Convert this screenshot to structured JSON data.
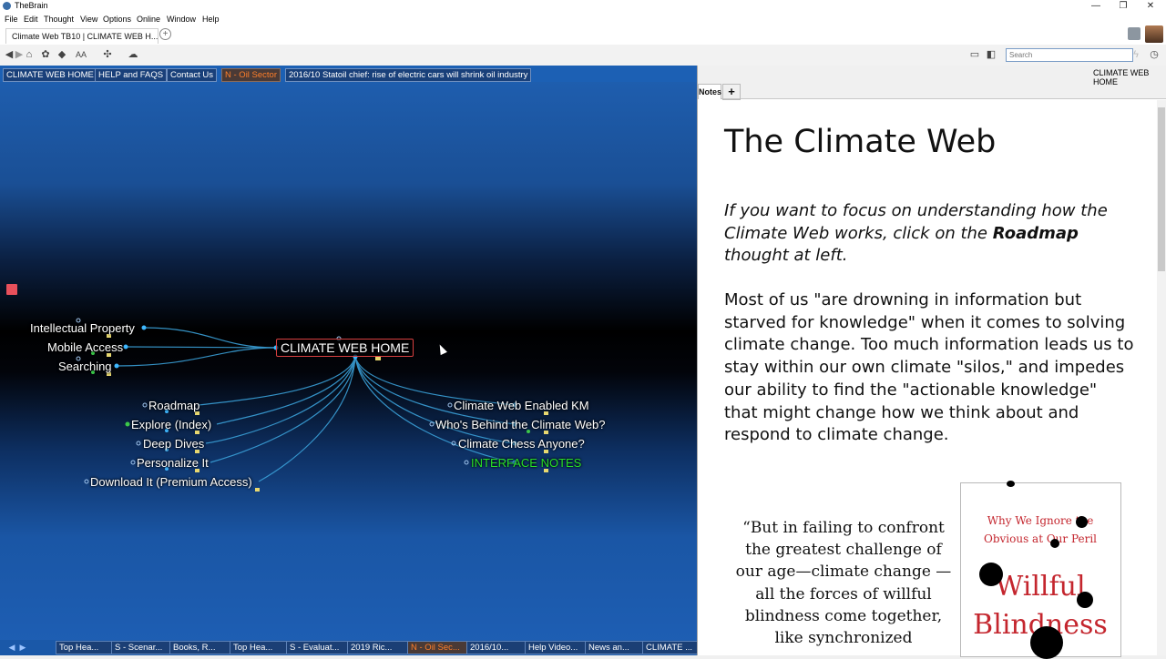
{
  "app": {
    "title": "TheBrain"
  },
  "window_controls": {
    "minimize": "—",
    "restore": "❐",
    "close": "✕"
  },
  "menu": [
    "File",
    "Edit",
    "Thought",
    "View",
    "Options",
    "Online",
    "Window",
    "Help"
  ],
  "tab": {
    "label": "Climate Web TB10 | CLIMATE WEB H...",
    "add": "+"
  },
  "toolbar": {
    "search_placeholder": "Search",
    "font_label": "AA"
  },
  "brain": {
    "pins": [
      "CLIMATE WEB HOME",
      "HELP and FAQS",
      "Contact Us",
      "N - Oil Sector",
      "2016/10 Statoil chief: rise of electric cars will shrink oil industry"
    ],
    "central": "CLIMATE WEB HOME",
    "left_thoughts": [
      "Intellectual Property",
      "Mobile Access",
      "Searching"
    ],
    "children_left": [
      "Roadmap",
      "Explore (Index)",
      "Deep Dives",
      "Personalize It",
      "Download It (Premium Access)"
    ],
    "children_right": [
      "Climate Web Enabled KM",
      "Who's Behind the Climate Web?",
      "Climate Chess Anyone?",
      "INTERFACE NOTES"
    ],
    "bottom_tabs": [
      "Top Hea...",
      "S - Scenar...",
      "Books, R...",
      "Top Hea...",
      "S - Evaluat...",
      "2019 Ric...",
      "N - Oil Sec...",
      "2016/10...",
      "Help Video...",
      "News an...",
      "CLIMATE ..."
    ]
  },
  "notes": {
    "breadcrumb": "CLIMATE WEB HOME",
    "tab_label": "Notes",
    "add_label": "+",
    "title": "The Climate Web",
    "italic_pre": "If you want to focus on understanding how the Climate Web works, click on the ",
    "italic_bold": "Roadmap",
    "italic_post": " thought at left.",
    "body": "Most of us \"are drowning in information but starved for knowledge\" when it comes to solving climate change. Too much information leads us to stay within our own climate \"silos,\" and impedes our ability to find the \"actionable knowledge\" that might change how we think about and respond to climate change.",
    "quote": "“But in failing to confront the greatest challenge of our age—climate change —all the forces of willful blindness come together, like synchronized",
    "book_subtitle": "Why We Ignore the Obvious at Our Peril",
    "book_title": "Willful Blindness"
  }
}
